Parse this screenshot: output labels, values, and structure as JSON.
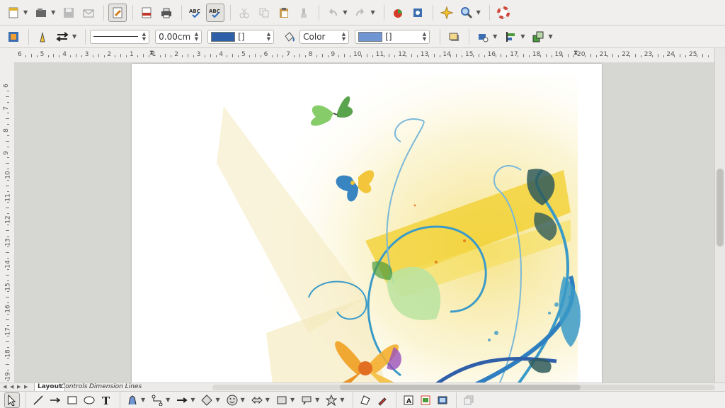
{
  "line_style": {
    "field_value": ""
  },
  "line_width": {
    "field_value": "0.00cm"
  },
  "line_color": {
    "field_value": "[]",
    "swatch": "#2f5fa8"
  },
  "area_style": {
    "field_value": "Color"
  },
  "area_color": {
    "field_value": "[]",
    "swatch": "#6f95d2"
  },
  "hruler": {
    "labels": [
      "6",
      "5",
      "4",
      "3",
      "2",
      "1",
      "1",
      "2",
      "3",
      "4",
      "5",
      "6",
      "7",
      "8",
      "9",
      "10",
      "11",
      "12",
      "13",
      "14",
      "15",
      "16",
      "17",
      "18",
      "19",
      "20",
      "21",
      "22",
      "23",
      "24",
      "25"
    ]
  },
  "vruler": {
    "labels": [
      "6",
      "7",
      "8",
      "9",
      "10",
      "11",
      "12",
      "13",
      "14",
      "15",
      "16",
      "17",
      "18",
      "19"
    ]
  },
  "tabs": {
    "layout": "Layout",
    "controls": "Controls",
    "dimension_lines": "Dimension Lines"
  },
  "colors": {
    "accent": "#2f5fa8",
    "toolbar_bg": "#f0efed",
    "page_bg": "#ffffff",
    "work_bg": "#d6d6d3"
  }
}
